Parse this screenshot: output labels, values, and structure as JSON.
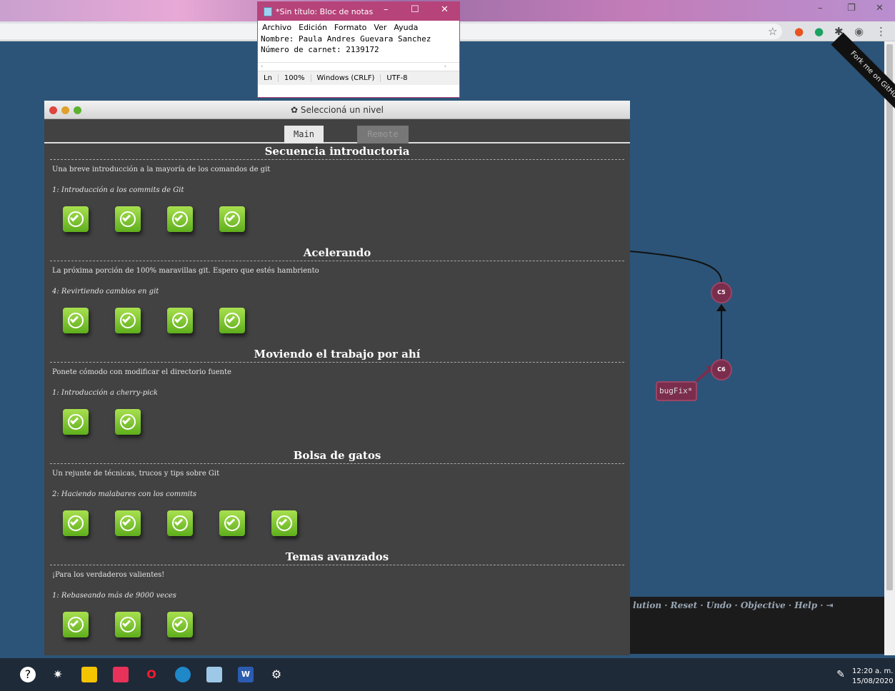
{
  "notepad": {
    "title": "*Sin título: Bloc de notas",
    "menu": [
      "Archivo",
      "Edición",
      "Formato",
      "Ver",
      "Ayuda"
    ],
    "lines": [
      "Nombre: Paula Andres Guevara Sanchez",
      "Número de carnet: 2139172"
    ],
    "status": {
      "position": "Ln",
      "zoom": "100%",
      "eol": "Windows (CRLF)",
      "encoding": "UTF-8"
    }
  },
  "ribbon": "Fork me on GitHub",
  "dialog": {
    "title": "Seleccioná un nivel",
    "tabs": {
      "main": "Main",
      "remote": "Remote"
    },
    "sequences": [
      {
        "title": "Secuencia introductoria",
        "about": "Una breve introducción a la mayoría de los comandos de git",
        "level": "1: Introducción a los commits de Git",
        "count": 4
      },
      {
        "title": "Acelerando",
        "about": "La próxima porción de 100% maravillas git. Espero que estés hambriento",
        "level": "4: Revirtiendo cambios en git",
        "count": 4
      },
      {
        "title": "Moviendo el trabajo por ahí",
        "about": "Ponete cómodo con modificar el directorio fuente",
        "level": "1: Introducción a cherry-pick",
        "count": 2
      },
      {
        "title": "Bolsa de gatos",
        "about": "Un rejunte de técnicas, trucos y tips sobre Git",
        "level": "2: Haciendo malabares con los commits",
        "count": 5
      },
      {
        "title": "Temas avanzados",
        "about": "¡Para los verdaderos valientes!",
        "level": "1: Rebaseando más de 9000 veces",
        "count": 3
      }
    ]
  },
  "tree": {
    "commits": [
      "C5",
      "C6"
    ],
    "branch": "bugFix*"
  },
  "commands": "lution · Reset · Undo · Objective · Help · ",
  "clock": {
    "time": "12:20 a. m.",
    "date": "15/08/2020"
  }
}
